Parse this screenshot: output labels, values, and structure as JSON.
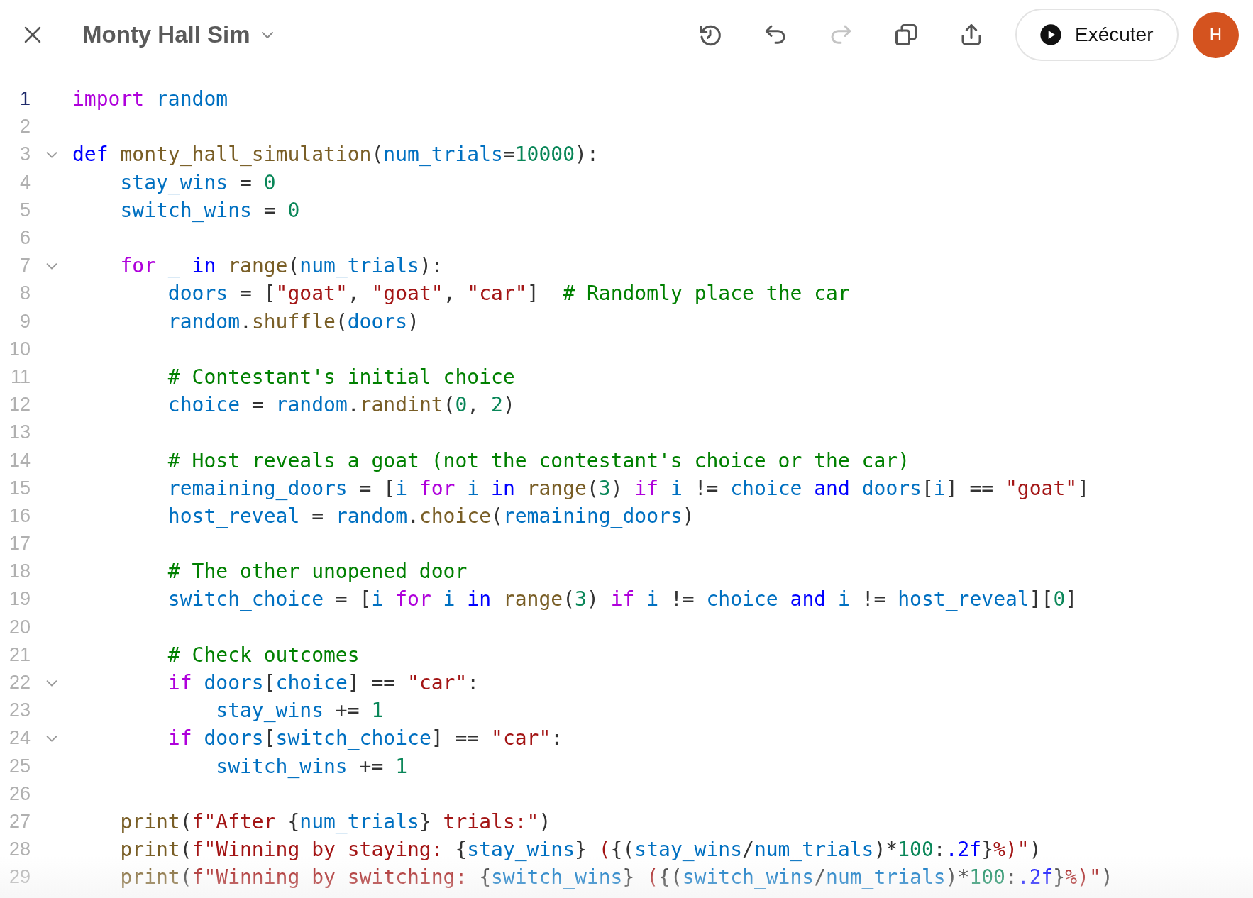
{
  "header": {
    "title": "Monty Hall Sim",
    "tools": [
      {
        "kind": "history",
        "disabled": false
      },
      {
        "kind": "undo",
        "disabled": false
      },
      {
        "kind": "redo",
        "disabled": true
      },
      {
        "kind": "copy",
        "disabled": false
      },
      {
        "kind": "share",
        "disabled": false
      }
    ],
    "run_label": "Exécuter",
    "avatar": "H"
  },
  "editor": {
    "lines": [
      {
        "number": "1",
        "active": true,
        "foldable": false,
        "tokens": [
          {
            "kind": "kw",
            "text": "import"
          },
          {
            "kind": "var",
            "text": " random"
          }
        ]
      },
      {
        "number": "2",
        "active": false,
        "foldable": false
      },
      {
        "number": "3",
        "active": false,
        "foldable": true,
        "tokens": [
          {
            "kind": "kw2",
            "text": "def"
          },
          {
            "kind": "fn",
            "text": " monty_hall_simulation"
          },
          {
            "kind": "p",
            "text": "("
          },
          {
            "kind": "var",
            "text": "num_trials"
          },
          {
            "kind": "p",
            "text": "="
          },
          {
            "kind": "num",
            "text": "10000"
          },
          {
            "kind": "p",
            "text": "):"
          }
        ]
      },
      {
        "number": "4",
        "active": false,
        "foldable": false,
        "tokens": [
          {
            "kind": "var",
            "text": "    stay_wins"
          },
          {
            "kind": "p",
            "text": " = "
          },
          {
            "kind": "num",
            "text": "0"
          }
        ]
      },
      {
        "number": "5",
        "active": false,
        "foldable": false,
        "tokens": [
          {
            "kind": "var",
            "text": "    switch_wins"
          },
          {
            "kind": "p",
            "text": " = "
          },
          {
            "kind": "num",
            "text": "0"
          }
        ]
      },
      {
        "number": "6",
        "active": false,
        "foldable": false
      },
      {
        "number": "7",
        "active": false,
        "foldable": true,
        "tokens": [
          {
            "kind": "kw",
            "text": "    for"
          },
          {
            "kind": "var",
            "text": " _"
          },
          {
            "kind": "kw2",
            "text": " in"
          },
          {
            "kind": "fn",
            "text": " range"
          },
          {
            "kind": "p",
            "text": "("
          },
          {
            "kind": "var",
            "text": "num_trials"
          },
          {
            "kind": "p",
            "text": "):"
          }
        ]
      },
      {
        "number": "8",
        "active": false,
        "foldable": false,
        "tokens": [
          {
            "kind": "var",
            "text": "        doors"
          },
          {
            "kind": "p",
            "text": " = ["
          },
          {
            "kind": "str",
            "text": "\"goat\""
          },
          {
            "kind": "p",
            "text": ", "
          },
          {
            "kind": "str",
            "text": "\"goat\""
          },
          {
            "kind": "p",
            "text": ", "
          },
          {
            "kind": "str",
            "text": "\"car\""
          },
          {
            "kind": "p",
            "text": "]"
          },
          {
            "kind": "cmt",
            "text": "  # Randomly place the car"
          }
        ]
      },
      {
        "number": "9",
        "active": false,
        "foldable": false,
        "tokens": [
          {
            "kind": "var",
            "text": "        random"
          },
          {
            "kind": "p",
            "text": "."
          },
          {
            "kind": "fn",
            "text": "shuffle"
          },
          {
            "kind": "p",
            "text": "("
          },
          {
            "kind": "var",
            "text": "doors"
          },
          {
            "kind": "p",
            "text": ")"
          }
        ]
      },
      {
        "number": "10",
        "active": false,
        "foldable": false
      },
      {
        "number": "11",
        "active": false,
        "foldable": false,
        "tokens": [
          {
            "kind": "cmt",
            "text": "        # Contestant's initial choice"
          }
        ]
      },
      {
        "number": "12",
        "active": false,
        "foldable": false,
        "tokens": [
          {
            "kind": "var",
            "text": "        choice"
          },
          {
            "kind": "p",
            "text": " = "
          },
          {
            "kind": "var",
            "text": "random"
          },
          {
            "kind": "p",
            "text": "."
          },
          {
            "kind": "fn",
            "text": "randint"
          },
          {
            "kind": "p",
            "text": "("
          },
          {
            "kind": "num",
            "text": "0"
          },
          {
            "kind": "p",
            "text": ", "
          },
          {
            "kind": "num",
            "text": "2"
          },
          {
            "kind": "p",
            "text": ")"
          }
        ]
      },
      {
        "number": "13",
        "active": false,
        "foldable": false
      },
      {
        "number": "14",
        "active": false,
        "foldable": false,
        "tokens": [
          {
            "kind": "cmt",
            "text": "        # Host reveals a goat (not the contestant's choice or the car)"
          }
        ]
      },
      {
        "number": "15",
        "active": false,
        "foldable": false,
        "tokens": [
          {
            "kind": "var",
            "text": "        remaining_doors"
          },
          {
            "kind": "p",
            "text": " = ["
          },
          {
            "kind": "var",
            "text": "i"
          },
          {
            "kind": "kw",
            "text": " for"
          },
          {
            "kind": "var",
            "text": " i"
          },
          {
            "kind": "kw2",
            "text": " in"
          },
          {
            "kind": "fn",
            "text": " range"
          },
          {
            "kind": "p",
            "text": "("
          },
          {
            "kind": "num",
            "text": "3"
          },
          {
            "kind": "p",
            "text": ")"
          },
          {
            "kind": "kw",
            "text": " if"
          },
          {
            "kind": "var",
            "text": " i"
          },
          {
            "kind": "p",
            "text": " != "
          },
          {
            "kind": "var",
            "text": "choice"
          },
          {
            "kind": "kw2",
            "text": " and"
          },
          {
            "kind": "var",
            "text": " doors"
          },
          {
            "kind": "p",
            "text": "["
          },
          {
            "kind": "var",
            "text": "i"
          },
          {
            "kind": "p",
            "text": "] == "
          },
          {
            "kind": "str",
            "text": "\"goat\""
          },
          {
            "kind": "p",
            "text": "]"
          }
        ]
      },
      {
        "number": "16",
        "active": false,
        "foldable": false,
        "tokens": [
          {
            "kind": "var",
            "text": "        host_reveal"
          },
          {
            "kind": "p",
            "text": " = "
          },
          {
            "kind": "var",
            "text": "random"
          },
          {
            "kind": "p",
            "text": "."
          },
          {
            "kind": "fn",
            "text": "choice"
          },
          {
            "kind": "p",
            "text": "("
          },
          {
            "kind": "var",
            "text": "remaining_doors"
          },
          {
            "kind": "p",
            "text": ")"
          }
        ]
      },
      {
        "number": "17",
        "active": false,
        "foldable": false
      },
      {
        "number": "18",
        "active": false,
        "foldable": false,
        "tokens": [
          {
            "kind": "cmt",
            "text": "        # The other unopened door"
          }
        ]
      },
      {
        "number": "19",
        "active": false,
        "foldable": false,
        "tokens": [
          {
            "kind": "var",
            "text": "        switch_choice"
          },
          {
            "kind": "p",
            "text": " = ["
          },
          {
            "kind": "var",
            "text": "i"
          },
          {
            "kind": "kw",
            "text": " for"
          },
          {
            "kind": "var",
            "text": " i"
          },
          {
            "kind": "kw2",
            "text": " in"
          },
          {
            "kind": "fn",
            "text": " range"
          },
          {
            "kind": "p",
            "text": "("
          },
          {
            "kind": "num",
            "text": "3"
          },
          {
            "kind": "p",
            "text": ")"
          },
          {
            "kind": "kw",
            "text": " if"
          },
          {
            "kind": "var",
            "text": " i"
          },
          {
            "kind": "p",
            "text": " != "
          },
          {
            "kind": "var",
            "text": "choice"
          },
          {
            "kind": "kw2",
            "text": " and"
          },
          {
            "kind": "var",
            "text": " i"
          },
          {
            "kind": "p",
            "text": " != "
          },
          {
            "kind": "var",
            "text": "host_reveal"
          },
          {
            "kind": "p",
            "text": "]["
          },
          {
            "kind": "num",
            "text": "0"
          },
          {
            "kind": "p",
            "text": "]"
          }
        ]
      },
      {
        "number": "20",
        "active": false,
        "foldable": false
      },
      {
        "number": "21",
        "active": false,
        "foldable": false,
        "tokens": [
          {
            "kind": "cmt",
            "text": "        # Check outcomes"
          }
        ]
      },
      {
        "number": "22",
        "active": false,
        "foldable": true,
        "tokens": [
          {
            "kind": "kw",
            "text": "        if"
          },
          {
            "kind": "var",
            "text": " doors"
          },
          {
            "kind": "p",
            "text": "["
          },
          {
            "kind": "var",
            "text": "choice"
          },
          {
            "kind": "p",
            "text": "] == "
          },
          {
            "kind": "str",
            "text": "\"car\""
          },
          {
            "kind": "p",
            "text": ":"
          }
        ]
      },
      {
        "number": "23",
        "active": false,
        "foldable": false,
        "tokens": [
          {
            "kind": "var",
            "text": "            stay_wins"
          },
          {
            "kind": "p",
            "text": " += "
          },
          {
            "kind": "num",
            "text": "1"
          }
        ]
      },
      {
        "number": "24",
        "active": false,
        "foldable": true,
        "tokens": [
          {
            "kind": "kw",
            "text": "        if"
          },
          {
            "kind": "var",
            "text": " doors"
          },
          {
            "kind": "p",
            "text": "["
          },
          {
            "kind": "var",
            "text": "switch_choice"
          },
          {
            "kind": "p",
            "text": "] == "
          },
          {
            "kind": "str",
            "text": "\"car\""
          },
          {
            "kind": "p",
            "text": ":"
          }
        ]
      },
      {
        "number": "25",
        "active": false,
        "foldable": false,
        "tokens": [
          {
            "kind": "var",
            "text": "            switch_wins"
          },
          {
            "kind": "p",
            "text": " += "
          },
          {
            "kind": "num",
            "text": "1"
          }
        ]
      },
      {
        "number": "26",
        "active": false,
        "foldable": false
      },
      {
        "number": "27",
        "active": false,
        "foldable": false,
        "tokens": [
          {
            "kind": "fn",
            "text": "    print"
          },
          {
            "kind": "p",
            "text": "("
          },
          {
            "kind": "str",
            "text": "f\"After "
          },
          {
            "kind": "p",
            "text": "{"
          },
          {
            "kind": "var",
            "text": "num_trials"
          },
          {
            "kind": "p",
            "text": "}"
          },
          {
            "kind": "str",
            "text": " trials:\""
          },
          {
            "kind": "p",
            "text": ")"
          }
        ]
      },
      {
        "number": "28",
        "active": false,
        "foldable": false,
        "tokens": [
          {
            "kind": "fn",
            "text": "    print"
          },
          {
            "kind": "p",
            "text": "("
          },
          {
            "kind": "str",
            "text": "f\"Winning by staying: "
          },
          {
            "kind": "p",
            "text": "{"
          },
          {
            "kind": "var",
            "text": "stay_wins"
          },
          {
            "kind": "p",
            "text": "}"
          },
          {
            "kind": "str",
            "text": " ("
          },
          {
            "kind": "p",
            "text": "{("
          },
          {
            "kind": "var",
            "text": "stay_wins"
          },
          {
            "kind": "p",
            "text": "/"
          },
          {
            "kind": "var",
            "text": "num_trials"
          },
          {
            "kind": "p",
            "text": ")*"
          },
          {
            "kind": "num",
            "text": "100"
          },
          {
            "kind": "p",
            "text": ":"
          },
          {
            "kind": "fmt",
            "text": ".2f"
          },
          {
            "kind": "p",
            "text": "}"
          },
          {
            "kind": "str",
            "text": "%)\""
          },
          {
            "kind": "p",
            "text": ")"
          }
        ]
      },
      {
        "number": "29",
        "active": false,
        "foldable": false,
        "tokens": [
          {
            "kind": "fn",
            "text": "    print"
          },
          {
            "kind": "p",
            "text": "("
          },
          {
            "kind": "str",
            "text": "f\"Winning by switching: "
          },
          {
            "kind": "p",
            "text": "{"
          },
          {
            "kind": "var",
            "text": "switch_wins"
          },
          {
            "kind": "p",
            "text": "}"
          },
          {
            "kind": "str",
            "text": " ("
          },
          {
            "kind": "p",
            "text": "{("
          },
          {
            "kind": "var",
            "text": "switch_wins"
          },
          {
            "kind": "p",
            "text": "/"
          },
          {
            "kind": "var",
            "text": "num_trials"
          },
          {
            "kind": "p",
            "text": ")*"
          },
          {
            "kind": "num",
            "text": "100"
          },
          {
            "kind": "p",
            "text": ":"
          },
          {
            "kind": "fmt",
            "text": ".2f"
          },
          {
            "kind": "p",
            "text": "}"
          },
          {
            "kind": "str",
            "text": "%)\""
          },
          {
            "kind": "p",
            "text": ")"
          }
        ]
      }
    ]
  }
}
